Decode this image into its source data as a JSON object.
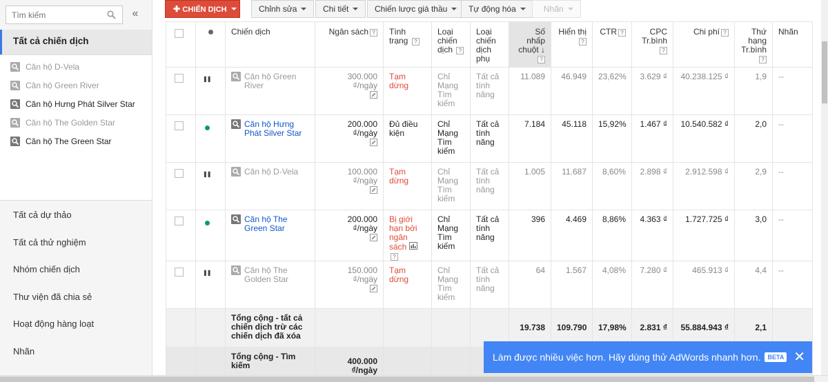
{
  "sidebar": {
    "search_placeholder": "Tìm kiếm",
    "collapse_glyph": "«",
    "all_campaigns": "Tất cả chiến dịch",
    "campaigns": [
      {
        "name": "Căn hộ D-Vela",
        "state": "paused"
      },
      {
        "name": "Căn hộ Green River",
        "state": "paused"
      },
      {
        "name": "Căn hộ Hưng Phát Silver Star",
        "state": "active"
      },
      {
        "name": "Căn hộ The Golden Star",
        "state": "paused"
      },
      {
        "name": "Căn hộ The Green Star",
        "state": "active"
      }
    ],
    "nav": [
      "Tất cả dự thảo",
      "Tất cả thử nghiệm",
      "Nhóm chiến dịch",
      "Thư viện đã chia sẻ",
      "Hoạt động hàng loạt",
      "Nhãn"
    ]
  },
  "toolbar": {
    "new_campaign": "CHIẾN DỊCH",
    "edit": "Chỉnh sửa",
    "details": "Chi tiết",
    "bid_strategy": "Chiến lược giá thầu",
    "automate": "Tự động hóa",
    "labels": "Nhãn"
  },
  "headers": {
    "campaign": "Chiến dịch",
    "budget": "Ngân sách",
    "status": "Tình trạng",
    "campaign_type": "Loại chiến dịch",
    "campaign_subtype": "Loại chiến dịch phụ",
    "clicks": "Số nhấp chuột",
    "impressions": "Hiển thị",
    "ctr": "CTR",
    "avg_cpc": "CPC Tr.bình",
    "cost": "Chi phí",
    "avg_pos": "Thứ hạng Tr.bình",
    "labels": "Nhãn",
    "help": "?"
  },
  "rows": [
    {
      "state": "paused",
      "name": "Căn hộ Green River",
      "budget": "300.000 ₫/ngày",
      "status": "Tạm dừng",
      "status_kind": "paused",
      "type": "Chỉ Mạng Tìm kiếm",
      "subtype": "Tất cả tính năng",
      "clicks": "11.089",
      "impr": "46.949",
      "ctr": "23,62%",
      "cpc": "3.629 ₫",
      "cost": "40.238.125 ₫",
      "pos": "1,9",
      "labels": "--"
    },
    {
      "state": "active",
      "name": "Căn hộ Hưng Phát Silver Star",
      "budget": "200.000 ₫/ngày",
      "status": "Đủ điều kiện",
      "status_kind": "ok",
      "type": "Chỉ Mạng Tìm kiếm",
      "subtype": "Tất cả tính năng",
      "clicks": "7.184",
      "impr": "45.118",
      "ctr": "15,92%",
      "cpc": "1.467 ₫",
      "cost": "10.540.582 ₫",
      "pos": "2,0",
      "labels": "--"
    },
    {
      "state": "paused",
      "name": "Căn hộ D-Vela",
      "budget": "100.000 ₫/ngày",
      "status": "Tạm dừng",
      "status_kind": "paused",
      "type": "Chỉ Mạng Tìm kiếm",
      "subtype": "Tất cả tính năng",
      "clicks": "1.005",
      "impr": "11.687",
      "ctr": "8,60%",
      "cpc": "2.898 ₫",
      "cost": "2.912.598 ₫",
      "pos": "2,9",
      "labels": "--"
    },
    {
      "state": "active",
      "name": "Căn hộ The Green Star",
      "budget": "200.000 ₫/ngày",
      "status": "Bị giới hạn bởi ngân sách",
      "status_kind": "limited",
      "type": "Chỉ Mạng Tìm kiếm",
      "subtype": "Tất cả tính năng",
      "clicks": "396",
      "impr": "4.469",
      "ctr": "8,86%",
      "cpc": "4.363 ₫",
      "cost": "1.727.725 ₫",
      "pos": "3,0",
      "labels": "--"
    },
    {
      "state": "paused",
      "name": "Căn hộ The Golden Star",
      "budget": "150.000 ₫/ngày",
      "status": "Tạm dừng",
      "status_kind": "paused",
      "type": "Chỉ Mạng Tìm kiếm",
      "subtype": "Tất cả tính năng",
      "clicks": "64",
      "impr": "1.567",
      "ctr": "4,08%",
      "cpc": "7.280 ₫",
      "cost": "465.913 ₫",
      "pos": "4,4",
      "labels": "--"
    }
  ],
  "totals": {
    "all_label": "Tổng cộng - tất cả chiến dịch trừ các chiến dịch đã xóa",
    "clicks": "19.738",
    "impr": "109.790",
    "ctr": "17,98%",
    "cpc": "2.831 ₫",
    "cost": "55.884.943 ₫",
    "pos": "2,1",
    "search_label": "Tổng cộng - Tìm kiếm",
    "search_budget": "400.000 ₫/ngày"
  },
  "banner": {
    "text": "Làm được nhiều việc hơn. Hãy dùng thử AdWords nhanh hơn.",
    "beta": "BETA",
    "close": "✕"
  },
  "colors": {
    "accent_red": "#dd4b39",
    "link_blue": "#1155cc",
    "banner_blue": "#4285f4",
    "active_green": "#0f9d58"
  },
  "icons": {
    "search": "search-icon",
    "pause": "pause-icon",
    "active": "active-dot-icon",
    "campaign": "campaign-search-icon",
    "edit": "edit-icon",
    "chart": "chart-icon",
    "sort": "sort-down-arrow-icon"
  }
}
